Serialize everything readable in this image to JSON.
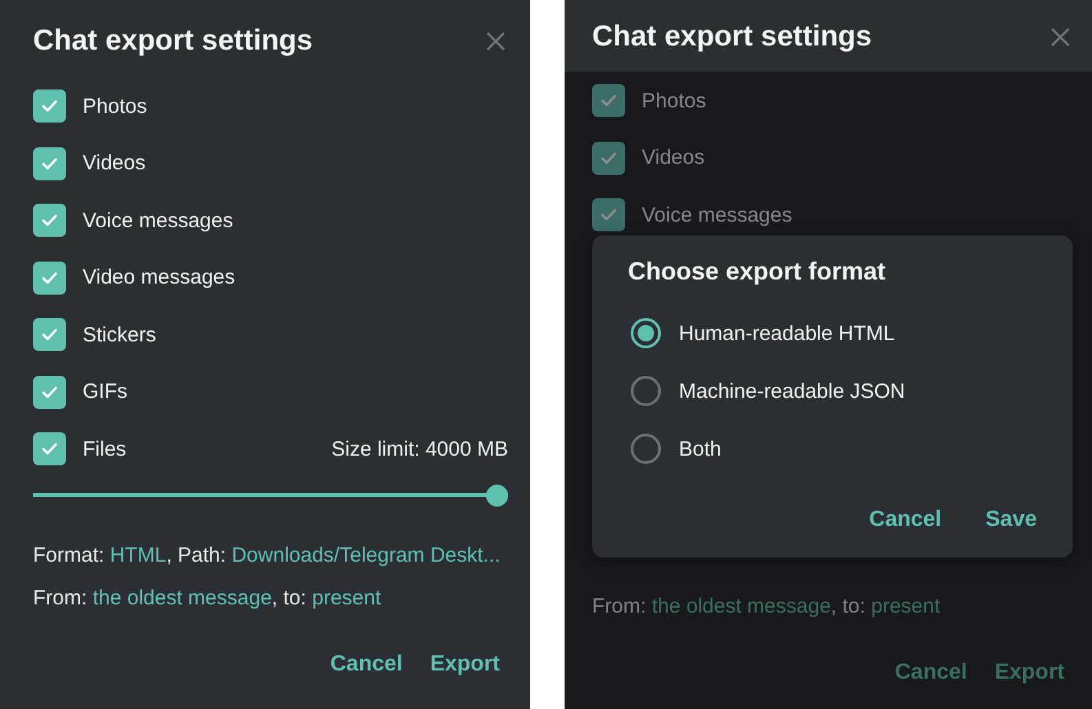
{
  "panels": [
    {
      "title": "Chat export settings",
      "dimmed": false,
      "options": [
        {
          "label": "Photos",
          "checked": true
        },
        {
          "label": "Videos",
          "checked": true
        },
        {
          "label": "Voice messages",
          "checked": true
        },
        {
          "label": "Video messages",
          "checked": true
        },
        {
          "label": "Stickers",
          "checked": true
        },
        {
          "label": "GIFs",
          "checked": true
        },
        {
          "label": "Files",
          "checked": true,
          "note": "Size limit: 4000 MB"
        }
      ],
      "slider": {
        "level": 1
      },
      "format_line": [
        {
          "kind": "plain",
          "text": "Format: "
        },
        {
          "kind": "link",
          "text": "HTML"
        },
        {
          "kind": "plain",
          "text": ", Path: "
        },
        {
          "kind": "link",
          "text": "Downloads/Telegram Deskt..."
        }
      ],
      "range_line": [
        {
          "kind": "plain",
          "text": "From: "
        },
        {
          "kind": "link",
          "text": "the oldest message"
        },
        {
          "kind": "plain",
          "text": ", to: "
        },
        {
          "kind": "link",
          "text": "present"
        }
      ],
      "buttons": [
        "Cancel",
        "Export"
      ]
    },
    {
      "title": "Chat export settings",
      "dimmed": true,
      "options": [
        {
          "label": "Photos",
          "checked": true
        },
        {
          "label": "Videos",
          "checked": true
        },
        {
          "label": "Voice messages",
          "checked": true
        }
      ],
      "range_line": [
        {
          "kind": "plain",
          "text": "From: "
        },
        {
          "kind": "link",
          "text": "the oldest message"
        },
        {
          "kind": "plain",
          "text": ", to: "
        },
        {
          "kind": "link",
          "text": "present"
        }
      ],
      "buttons": [
        "Cancel",
        "Export"
      ],
      "popup": {
        "title": "Choose export format",
        "options": [
          {
            "label": "Human-readable HTML",
            "selected": true
          },
          {
            "label": "Machine-readable JSON",
            "selected": false
          },
          {
            "label": "Both",
            "selected": false
          }
        ],
        "buttons": [
          "Cancel",
          "Save"
        ]
      }
    }
  ]
}
